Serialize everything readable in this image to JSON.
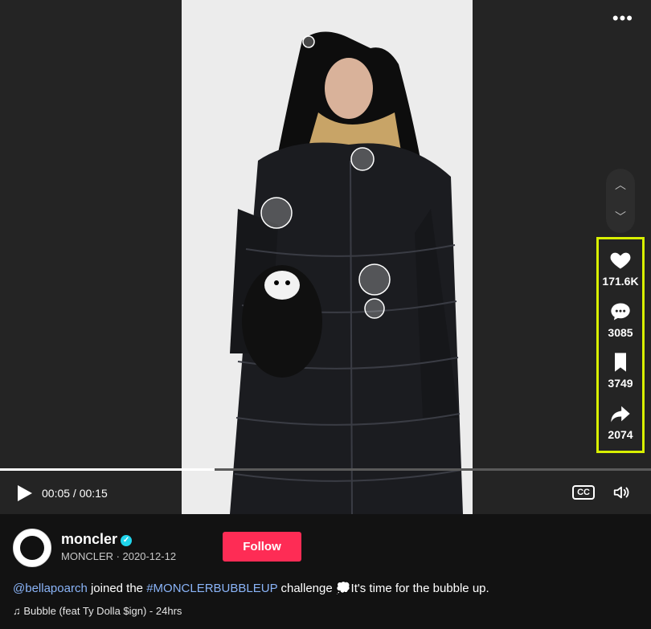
{
  "player": {
    "more_label": "•••",
    "time_current": "00:05",
    "time_total": "00:15",
    "time_display": "00:05 / 00:15",
    "progress": 0.33,
    "cc_label": "CC",
    "nav_up": "︿",
    "nav_down": "﹀"
  },
  "actions": {
    "likes": "171.6K",
    "comments": "3085",
    "bookmarks": "3749",
    "shares": "2074"
  },
  "author": {
    "username": "moncler",
    "display_name": "MONCLER",
    "date": "2020-12-12",
    "subline": "MONCLER · 2020-12-12",
    "follow_label": "Follow",
    "verified_mark": "✓",
    "avatar_text": "MONCLER"
  },
  "caption": {
    "mention": "@bellapoarch",
    "text1": " joined the ",
    "hashtag": "#MONCLERBUBBLEUP",
    "text2": " challenge 💭It's time for the bubble up."
  },
  "music": {
    "label": "♫ Bubble (feat Ty Dolla $ign) - 24hrs"
  },
  "colors": {
    "highlight": "#d8f000",
    "follow": "#fe2c55",
    "link": "#8ab4f8"
  }
}
